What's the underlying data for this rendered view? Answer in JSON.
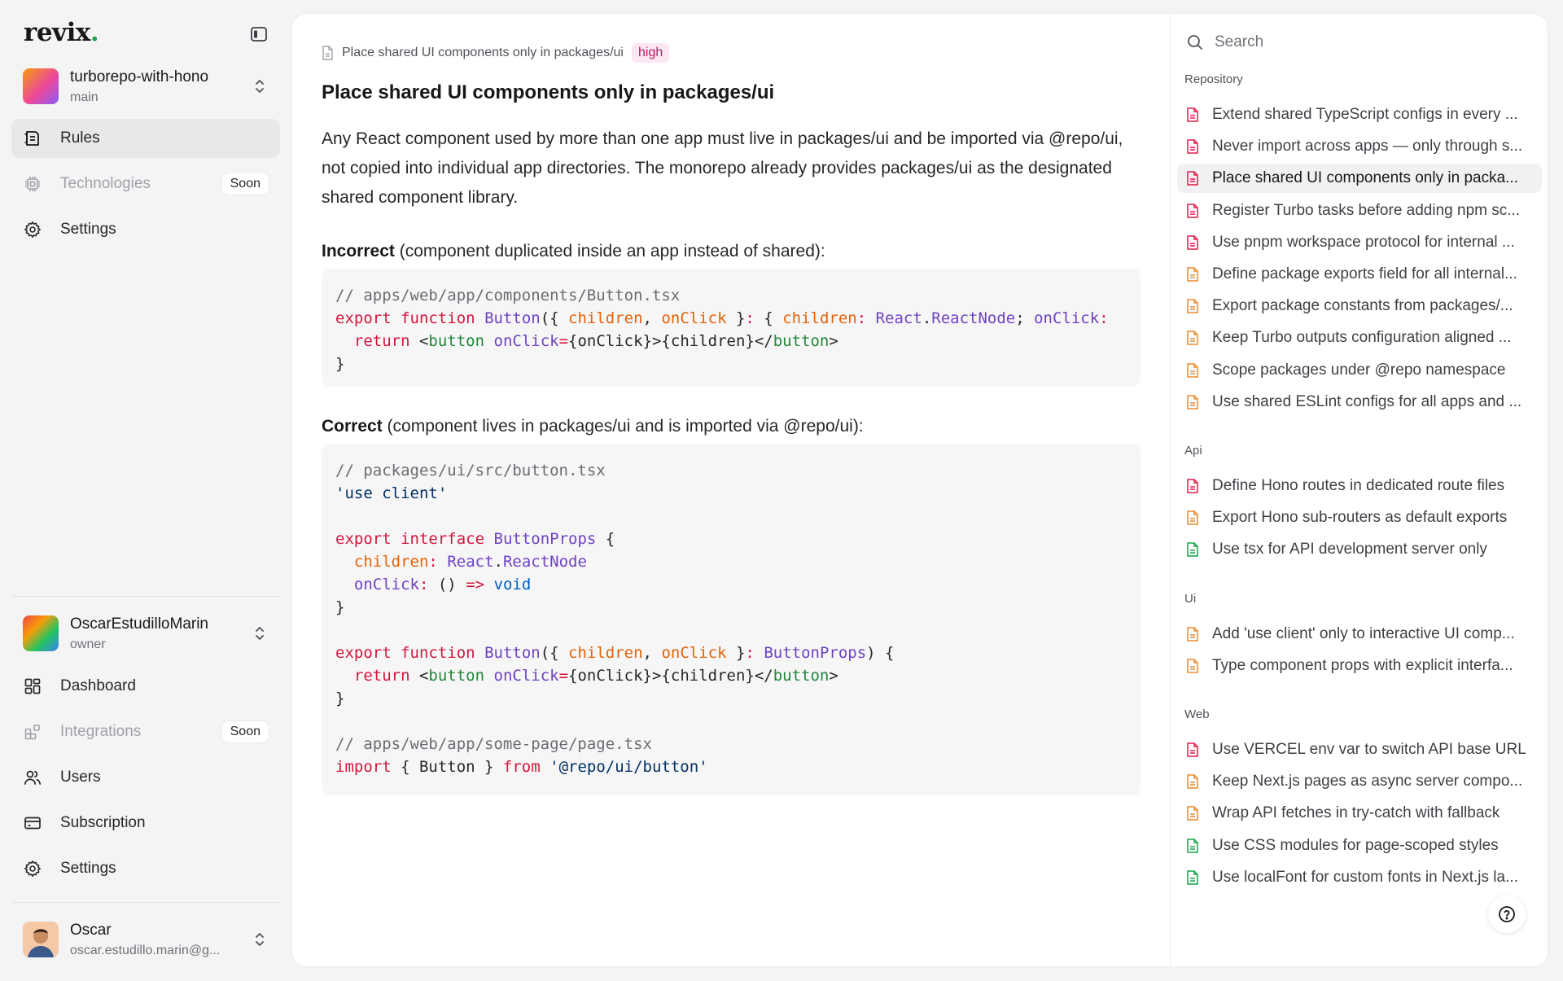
{
  "brand": {
    "name": "revix",
    "dot": "."
  },
  "project": {
    "name": "turborepo-with-hono",
    "branch": "main"
  },
  "nav_top": [
    {
      "label": "Rules",
      "icon": "rules-icon",
      "active": true
    },
    {
      "label": "Technologies",
      "icon": "chip-icon",
      "badge": "Soon",
      "disabled": true
    },
    {
      "label": "Settings",
      "icon": "gear-icon"
    }
  ],
  "org": {
    "name": "OscarEstudilloMarin",
    "role": "owner"
  },
  "nav_bottom": [
    {
      "label": "Dashboard",
      "icon": "dashboard-icon"
    },
    {
      "label": "Integrations",
      "icon": "integrations-icon",
      "badge": "Soon",
      "disabled": true
    },
    {
      "label": "Users",
      "icon": "users-icon"
    },
    {
      "label": "Subscription",
      "icon": "card-icon"
    },
    {
      "label": "Settings",
      "icon": "gear-icon"
    }
  ],
  "user": {
    "name": "Oscar",
    "email": "oscar.estudillo.marin@g..."
  },
  "rule": {
    "breadcrumb": "Place shared UI components only in packages/ui",
    "severity": "high",
    "title": "Place shared UI components only in packages/ui",
    "description": "Any React component used by more than one app must live in packages/ui and be imported via @repo/ui, not copied into individual app directories. The monorepo already provides packages/ui as the designated shared component library.",
    "incorrect_label": "Incorrect",
    "incorrect_note": " (component duplicated inside an app instead of shared):",
    "correct_label": "Correct",
    "correct_note": " (component lives in packages/ui and is imported via @repo/ui):",
    "code_incorrect": [
      [
        [
          "c",
          "// apps/web/app/components/Button.tsx"
        ]
      ],
      [
        [
          "k",
          "export"
        ],
        [
          "",
          " "
        ],
        [
          "k",
          "function"
        ],
        [
          "",
          " "
        ],
        [
          "f",
          "Button"
        ],
        [
          "",
          "({ "
        ],
        [
          "p",
          "children"
        ],
        [
          "",
          ", "
        ],
        [
          "p",
          "onClick"
        ],
        [
          "",
          " }"
        ],
        [
          "k",
          ":"
        ],
        [
          "",
          " { "
        ],
        [
          "p",
          "children"
        ],
        [
          "k",
          ":"
        ],
        [
          "",
          " "
        ],
        [
          "t",
          "React"
        ],
        [
          "",
          "."
        ],
        [
          "t",
          "ReactNode"
        ],
        [
          "",
          "; "
        ],
        [
          "f",
          "onClick"
        ],
        [
          "k",
          ":"
        ]
      ],
      [
        [
          "",
          "  "
        ],
        [
          "k",
          "return"
        ],
        [
          "",
          " <"
        ],
        [
          "g",
          "button"
        ],
        [
          "",
          " "
        ],
        [
          "f",
          "onClick"
        ],
        [
          "k",
          "="
        ],
        [
          "",
          "{onClick}>{children}</"
        ],
        [
          "g",
          "button"
        ],
        [
          "",
          ">"
        ]
      ],
      [
        [
          "",
          "}"
        ]
      ]
    ],
    "code_correct": [
      [
        [
          "c",
          "// packages/ui/src/button.tsx"
        ]
      ],
      [
        [
          "s",
          "'use client'"
        ]
      ],
      [
        [
          "",
          ""
        ]
      ],
      [
        [
          "k",
          "export"
        ],
        [
          "",
          " "
        ],
        [
          "k",
          "interface"
        ],
        [
          "",
          " "
        ],
        [
          "f",
          "ButtonProps"
        ],
        [
          "",
          " {"
        ]
      ],
      [
        [
          "",
          "  "
        ],
        [
          "p",
          "children"
        ],
        [
          "k",
          ":"
        ],
        [
          "",
          " "
        ],
        [
          "t",
          "React"
        ],
        [
          "",
          "."
        ],
        [
          "t",
          "ReactNode"
        ]
      ],
      [
        [
          "",
          "  "
        ],
        [
          "f",
          "onClick"
        ],
        [
          "k",
          ":"
        ],
        [
          "",
          " () "
        ],
        [
          "k",
          "=>"
        ],
        [
          "",
          " "
        ],
        [
          "n",
          "void"
        ]
      ],
      [
        [
          "",
          "}"
        ]
      ],
      [
        [
          "",
          ""
        ]
      ],
      [
        [
          "k",
          "export"
        ],
        [
          "",
          " "
        ],
        [
          "k",
          "function"
        ],
        [
          "",
          " "
        ],
        [
          "f",
          "Button"
        ],
        [
          "",
          "({ "
        ],
        [
          "p",
          "children"
        ],
        [
          "",
          ", "
        ],
        [
          "p",
          "onClick"
        ],
        [
          "",
          " }"
        ],
        [
          "k",
          ":"
        ],
        [
          "",
          " "
        ],
        [
          "t",
          "ButtonProps"
        ],
        [
          "",
          ") {"
        ]
      ],
      [
        [
          "",
          "  "
        ],
        [
          "k",
          "return"
        ],
        [
          "",
          " <"
        ],
        [
          "g",
          "button"
        ],
        [
          "",
          " "
        ],
        [
          "f",
          "onClick"
        ],
        [
          "k",
          "="
        ],
        [
          "",
          "{onClick}>{children}</"
        ],
        [
          "g",
          "button"
        ],
        [
          "",
          ">"
        ]
      ],
      [
        [
          "",
          "}"
        ]
      ],
      [
        [
          "",
          ""
        ]
      ],
      [
        [
          "c",
          "// apps/web/app/some-page/page.tsx"
        ]
      ],
      [
        [
          "k",
          "import"
        ],
        [
          "",
          " { Button } "
        ],
        [
          "k",
          "from"
        ],
        [
          "",
          " "
        ],
        [
          "s",
          "'@repo/ui/button'"
        ]
      ]
    ]
  },
  "outline": {
    "search_placeholder": "Search",
    "groups": [
      {
        "label": "Repository",
        "items": [
          {
            "text": "Extend shared TypeScript configs in every ...",
            "color": "#e11d48"
          },
          {
            "text": "Never import across apps — only through s...",
            "color": "#e11d48"
          },
          {
            "text": "Place shared UI components only in packa...",
            "color": "#e11d48",
            "active": true
          },
          {
            "text": "Register Turbo tasks before adding npm sc...",
            "color": "#e11d48"
          },
          {
            "text": "Use pnpm workspace protocol for internal ...",
            "color": "#e11d48"
          },
          {
            "text": "Define package exports field for all internal...",
            "color": "#ea8a2e"
          },
          {
            "text": "Export package constants from packages/...",
            "color": "#ea8a2e"
          },
          {
            "text": "Keep Turbo outputs configuration aligned ...",
            "color": "#ea8a2e"
          },
          {
            "text": "Scope packages under @repo namespace",
            "color": "#ea8a2e"
          },
          {
            "text": "Use shared ESLint configs for all apps and ...",
            "color": "#ea8a2e"
          }
        ]
      },
      {
        "label": "Api",
        "items": [
          {
            "text": "Define Hono routes in dedicated route files",
            "color": "#e11d48"
          },
          {
            "text": "Export Hono sub-routers as default exports",
            "color": "#ea8a2e"
          },
          {
            "text": "Use tsx for API development server only",
            "color": "#16a34a"
          }
        ]
      },
      {
        "label": "Ui",
        "items": [
          {
            "text": "Add 'use client' only to interactive UI comp...",
            "color": "#ea8a2e"
          },
          {
            "text": "Type component props with explicit interfa...",
            "color": "#ea8a2e"
          }
        ]
      },
      {
        "label": "Web",
        "items": [
          {
            "text": "Use VERCEL env var to switch API base URL",
            "color": "#e11d48"
          },
          {
            "text": "Keep Next.js pages as async server compo...",
            "color": "#ea8a2e"
          },
          {
            "text": "Wrap API fetches in try-catch with fallback",
            "color": "#ea8a2e"
          },
          {
            "text": "Use CSS modules for page-scoped styles",
            "color": "#16a34a"
          },
          {
            "text": "Use localFont for custom fonts in Next.js la...",
            "color": "#16a34a"
          }
        ]
      }
    ]
  },
  "help": {
    "icon": "help-icon"
  }
}
